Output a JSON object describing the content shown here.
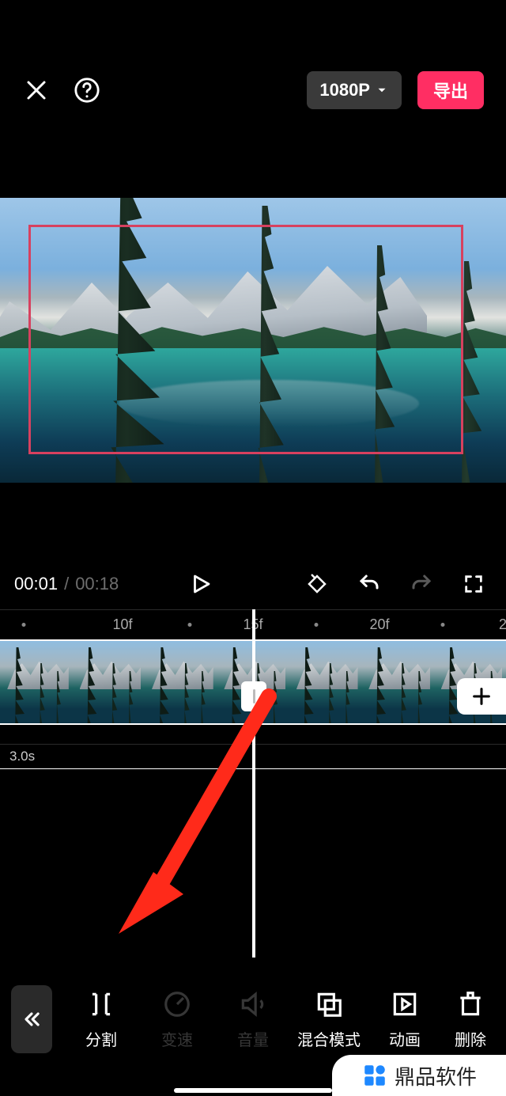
{
  "topbar": {
    "resolution": "1080P",
    "export_label": "导出"
  },
  "player": {
    "current_time": "00:01",
    "total_time": "00:18"
  },
  "ruler": {
    "marks": [
      "10f",
      "15f",
      "20f"
    ]
  },
  "track2": {
    "duration_label": "3.0s"
  },
  "toolbar": {
    "items": [
      {
        "key": "split",
        "label": "分割",
        "dim": false
      },
      {
        "key": "speed",
        "label": "变速",
        "dim": true
      },
      {
        "key": "volume",
        "label": "音量",
        "dim": true
      },
      {
        "key": "blend",
        "label": "混合模式",
        "dim": false
      },
      {
        "key": "animation",
        "label": "动画",
        "dim": false
      },
      {
        "key": "delete",
        "label": "删除",
        "dim": false
      }
    ]
  },
  "watermark": {
    "text": "鼎品软件"
  }
}
